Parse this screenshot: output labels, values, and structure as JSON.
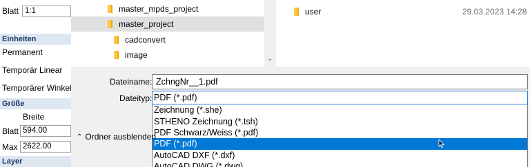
{
  "left_panel": {
    "blatt_label": "Blatt",
    "blatt_value": "1:1",
    "einheiten_header": "Einheiten",
    "permanent_label": "Permanent",
    "temp_linear_label": "Temporär Linear",
    "temp_angle_label": "Temporärer Winkel",
    "groesse_header": "Größe",
    "breite_label": "Breite",
    "blatt2_label": "Blatt",
    "blatt2_value": "594.00",
    "max_label": "Max",
    "max_value": "2622.00",
    "layer_header": "Layer"
  },
  "navigation": {
    "folders": [
      {
        "name": "master_mpds_project",
        "selected": false
      },
      {
        "name": "master_project",
        "selected": true
      },
      {
        "name": "cadconvert",
        "selected": false
      },
      {
        "name": "image",
        "selected": false
      }
    ]
  },
  "file_list": {
    "rows": [
      {
        "name": "user",
        "date": "29.03.2023 14:28"
      }
    ]
  },
  "form": {
    "filename_label": "Dateiname:",
    "filename_value": "ZchngNr__1.pdf",
    "filetype_label": "Dateityp:",
    "filetype_value": "PDF (*.pdf)"
  },
  "filetype_options": [
    {
      "label": "Zeichnung (*.she)",
      "highlighted": false
    },
    {
      "label": "STHENO Zeichnung (*.tsh)",
      "highlighted": false
    },
    {
      "label": "PDF Schwarz/Weiss (*.pdf)",
      "highlighted": false
    },
    {
      "label": "PDF (*.pdf)",
      "highlighted": true
    },
    {
      "label": "AutoCAD DXF (*.dxf)",
      "highlighted": false
    },
    {
      "label": "AutoCAD DWG (*.dwg)",
      "highlighted": false
    }
  ],
  "hide_folders_label": "Ordner ausblenden",
  "icons": {
    "folder": "folder-icon",
    "chevron_up": "chevron-up-icon",
    "scroll_down": "scroll-down-arrow-icon",
    "cursor": "mouse-pointer-icon"
  },
  "colors": {
    "selection_highlight": "#0078d7",
    "selected_folder": "#e0e0e0",
    "folder": "#ffc83d",
    "section_header": "#dde6f1"
  }
}
